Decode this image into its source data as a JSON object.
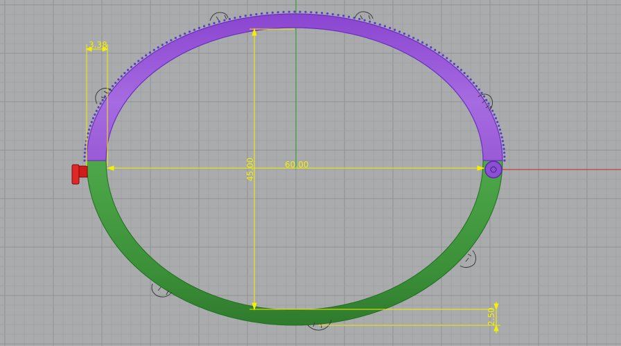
{
  "viewport": {
    "background": "#a9abad",
    "grid_minor_color": "#9ea1a4",
    "grid_major_color": "#8e9194",
    "axis_x_color": "#d02020",
    "axis_y_color": "#1f9a2a"
  },
  "ring": {
    "upper_half_color": "#9a5ad6",
    "upper_half_edge": "#6a2fc0",
    "lower_half_color": "#3a9a3a",
    "lower_half_edge": "#1f6f1f",
    "teeth_color": "#5a3ad0",
    "hinge_icon": "hinge-pin-icon",
    "clasp_icon": "clasp-icon",
    "clasp_color": "#d11a1a"
  },
  "dimensions": {
    "color": "#f4f000",
    "width_label": "60.00",
    "height_label": "45.00",
    "band_width_label": "3.38",
    "thickness_label": "2.50"
  }
}
